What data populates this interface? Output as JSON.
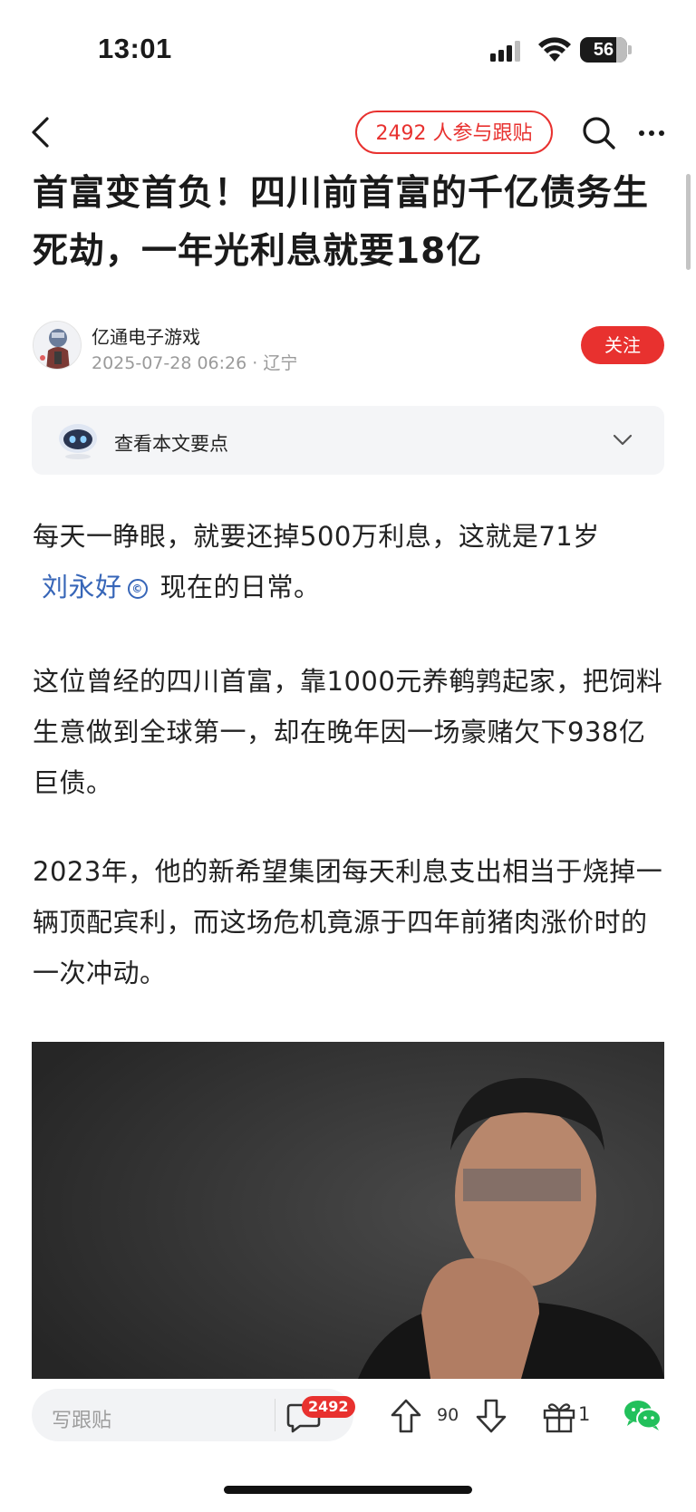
{
  "status_bar": {
    "time": "13:01",
    "battery": "56"
  },
  "nav": {
    "participants": "2492 人参与跟贴"
  },
  "article": {
    "title": "首富变首负！四川前首富的千亿债务生死劫，一年光利息就要18亿",
    "author": {
      "name": "亿通电子游戏",
      "meta": "2025-07-28 06:26 · 辽宁"
    },
    "follow_label": "关注",
    "summary_label": "查看本文要点",
    "para1_a": "每天一睁眼，就要还掉500万利息，这就是71岁",
    "para1_link": "刘永好",
    "para1_b": "现在的日常。",
    "para2": "这位曾经的四川首富，靠1000元养鹌鹑起家，把饲料生意做到全球第一，却在晚年因一场豪赌欠下938亿巨债。",
    "para3": "2023年，他的新希望集团每天利息支出相当于烧掉一辆顶配宾利，而这场危机竟源于四年前猪肉涨价时的一次冲动。"
  },
  "bottom_bar": {
    "input_placeholder": "写跟贴",
    "comment_count": "2492",
    "up_count": "90",
    "gift_count": "1"
  },
  "colors": {
    "accent": "#e8312f",
    "link": "#3766b8"
  }
}
